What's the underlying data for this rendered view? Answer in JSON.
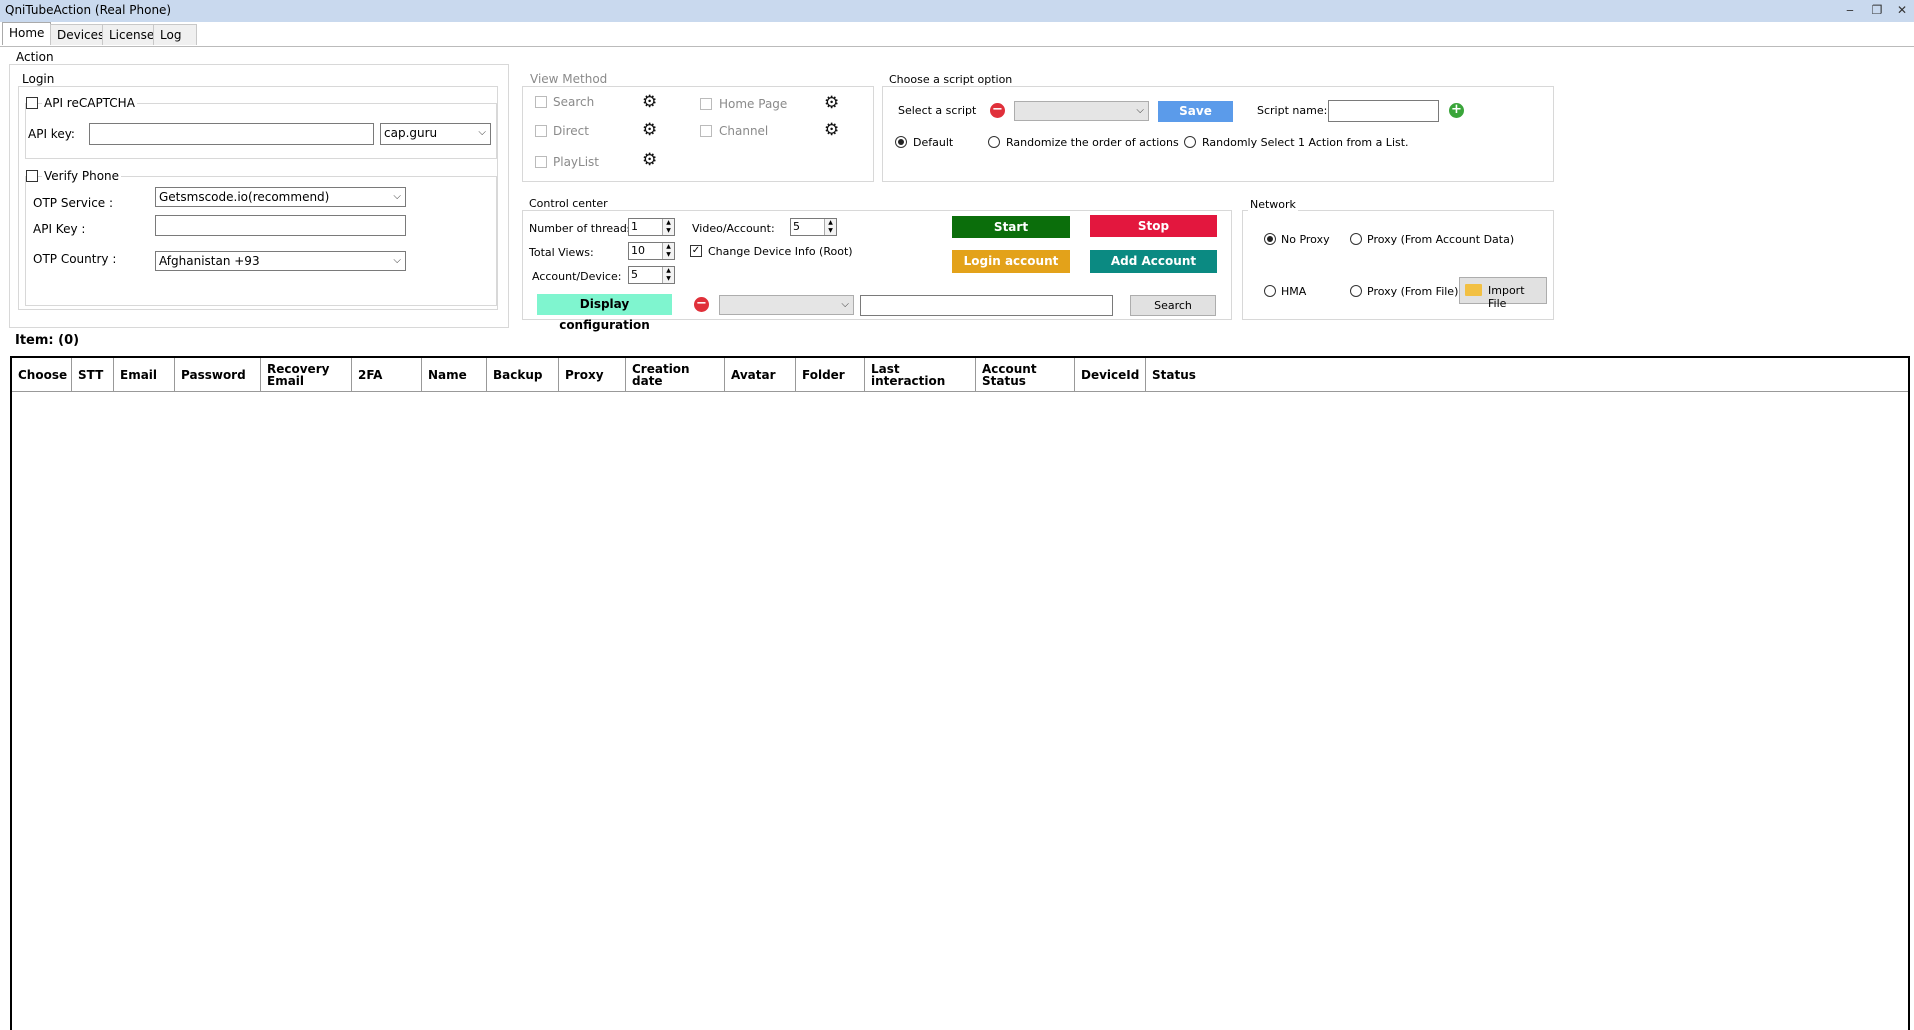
{
  "window": {
    "title": "QniTubeAction (Real Phone)",
    "minimize": "‒",
    "restore": "❐",
    "close": "✕"
  },
  "tabs": [
    "Home",
    "Devices",
    "License",
    "Log"
  ],
  "action": {
    "label": "Action"
  },
  "login": {
    "label": "Login",
    "recaptcha_label": "API reCAPTCHA",
    "api_key_label": "API key:",
    "api_key_value": "",
    "captcha_service": "cap.guru",
    "verify_phone_label": "Verify Phone",
    "otp_service_label": "OTP Service :",
    "otp_service_value": "Getsmscode.io(recommend)",
    "otp_api_key_label": "API Key :",
    "otp_api_key_value": "",
    "otp_country_label": "OTP Country :",
    "otp_country_value": "Afghanistan +93"
  },
  "view_method": {
    "label": "View Method",
    "search": "Search",
    "direct": "Direct",
    "playlist": "PlayList",
    "home_page": "Home Page",
    "channel": "Channel"
  },
  "script": {
    "label": "Choose a script option",
    "select_label": "Select a script",
    "selected": "",
    "save": "Save",
    "name_label": "Script name:",
    "name_value": "",
    "opt_default": "Default",
    "opt_randomize": "Randomize the order of actions",
    "opt_random_one": "Randomly Select 1 Action from a List."
  },
  "control": {
    "label": "Control center",
    "threads_label": "Number of threads:",
    "threads": "1",
    "video_label": "Video/Account:",
    "video": "5",
    "views_label": "Total Views:",
    "views": "10",
    "change_device_label": "Change Device Info (Root)",
    "account_device_label": "Account/Device:",
    "account_device": "5",
    "start": "Start",
    "stop": "Stop",
    "login_account": "Login account",
    "add_account": "Add Account",
    "display_config": "Display configuration",
    "filter_value": "",
    "search_value": "",
    "search_btn": "Search"
  },
  "network": {
    "label": "Network",
    "no_proxy": "No Proxy",
    "proxy_account": "Proxy (From Account Data)",
    "hma": "HMA",
    "proxy_file": "Proxy (From File)",
    "import_file": "Import File"
  },
  "items_label": "Item: (0)",
  "table": {
    "headers": [
      "Choose",
      "STT",
      "Email",
      "Password",
      "Recovery\nEmail",
      "2FA",
      "Name",
      "Backup",
      "Proxy",
      "Creation\ndate",
      "Avatar",
      "Folder",
      "Last\ninteraction",
      "Account\nStatus",
      "DeviceId",
      "Status"
    ]
  },
  "colors": {
    "start": "#0b6e0b",
    "stop": "#e3173e",
    "login": "#e3a21a",
    "add": "#0b8a82",
    "save": "#5b9bea",
    "display": "#7ff5cf"
  }
}
